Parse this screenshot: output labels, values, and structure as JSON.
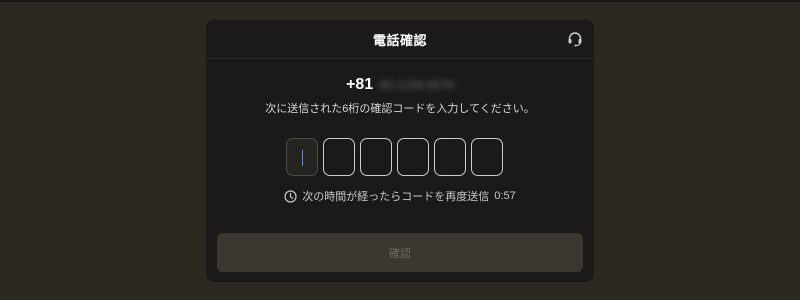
{
  "dialog": {
    "title": "電話確認",
    "support_icon": "headset-icon"
  },
  "phone": {
    "prefix": "+81",
    "number_masked": "80-1234-5678"
  },
  "instruction": "次に送信された6桁の確認コードを入力してください。",
  "otp": {
    "length": 6,
    "values": [
      "",
      "",
      "",
      "",
      "",
      ""
    ]
  },
  "resend": {
    "icon": "clock-icon",
    "text": "次の時間が経ったらコードを再度送信",
    "countdown": "0:57"
  },
  "confirm_label": "確認"
}
